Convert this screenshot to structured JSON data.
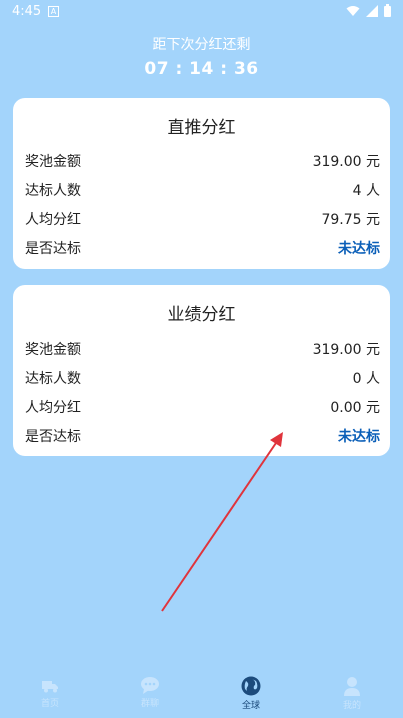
{
  "status_bar": {
    "time": "4:45"
  },
  "countdown": {
    "label": "距下次分红还剩",
    "time": "07 : 14 : 36"
  },
  "cards": [
    {
      "title": "直推分红",
      "rows": [
        {
          "label": "奖池金额",
          "value": "319.00 元"
        },
        {
          "label": "达标人数",
          "value": "4 人"
        },
        {
          "label": "人均分红",
          "value": "79.75 元"
        },
        {
          "label": "是否达标",
          "value": "未达标"
        }
      ]
    },
    {
      "title": "业绩分红",
      "rows": [
        {
          "label": "奖池金额",
          "value": "319.00 元"
        },
        {
          "label": "达标人数",
          "value": "0 人"
        },
        {
          "label": "人均分红",
          "value": "0.00 元"
        },
        {
          "label": "是否达标",
          "value": "未达标"
        }
      ]
    }
  ],
  "tabs": [
    {
      "label": "首页",
      "icon": "truck-icon"
    },
    {
      "label": "群聊",
      "icon": "chat-icon"
    },
    {
      "label": "全球",
      "icon": "globe-icon"
    },
    {
      "label": "我的",
      "icon": "person-icon"
    }
  ],
  "colors": {
    "background": "#a3d4fb",
    "status_text": "#0b5fb8",
    "arrow": "#e0343c"
  }
}
